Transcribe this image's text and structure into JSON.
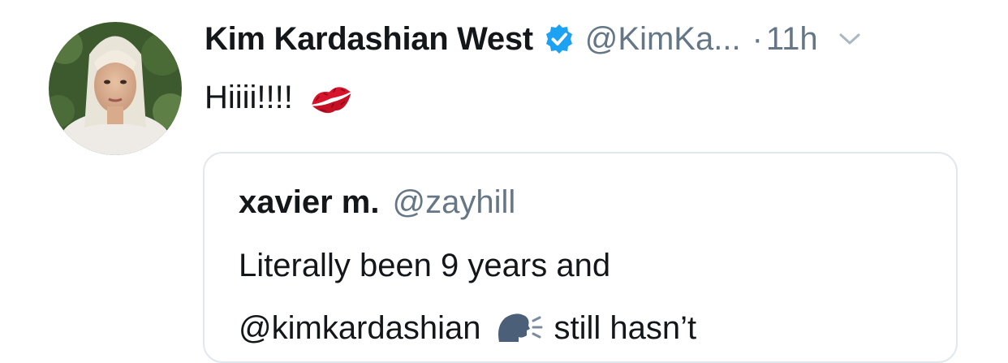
{
  "tweet": {
    "display_name": "Kim Kardashian West",
    "handle": "@KimKa...",
    "separator": "·",
    "time": "11h",
    "text": "Hiiii!!!!",
    "emoji": "kiss-mark-icon"
  },
  "quote": {
    "display_name": "xavier m.",
    "handle": "@zayhill",
    "line1": "Literally been 9 years and",
    "line2_mention": "@kimkardashian",
    "line2_rest": "still hasn’t",
    "emoji": "speaking-head-icon"
  },
  "colors": {
    "text": "#14171a",
    "secondary": "#657786",
    "verified": "#1da1f2",
    "card_border": "#e1e8ed"
  }
}
